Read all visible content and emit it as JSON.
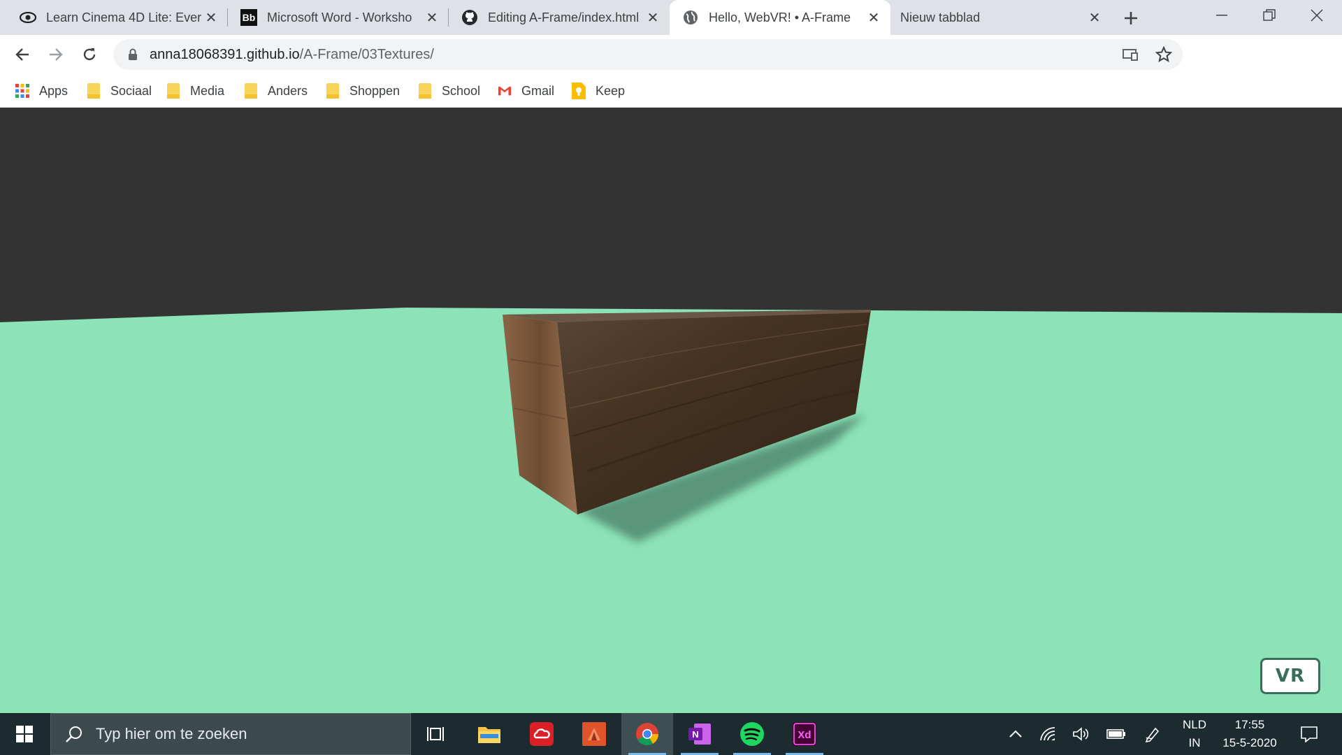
{
  "tabs": [
    {
      "title": "Learn Cinema 4D Lite: Every",
      "favicon": "eye-icon"
    },
    {
      "title": "Microsoft Word - Worksho",
      "favicon": "blackboard-icon",
      "favicon_text": "Bb"
    },
    {
      "title": "Editing A-Frame/index.html",
      "favicon": "github-icon"
    },
    {
      "title": "Hello, WebVR! • A-Frame",
      "favicon": "globe-icon",
      "active": true
    },
    {
      "title": "Nieuw tabblad",
      "favicon": "none"
    }
  ],
  "address": {
    "host": "anna18068391.github.io",
    "path": "/A-Frame/03Textures/"
  },
  "bookmarks": [
    {
      "label": "Apps",
      "icon": "apps-grid-icon"
    },
    {
      "label": "Sociaal",
      "icon": "folder-icon"
    },
    {
      "label": "Media",
      "icon": "folder-icon"
    },
    {
      "label": "Anders",
      "icon": "folder-icon"
    },
    {
      "label": "Shoppen",
      "icon": "folder-icon"
    },
    {
      "label": "School",
      "icon": "folder-icon"
    },
    {
      "label": "Gmail",
      "icon": "gmail-icon"
    },
    {
      "label": "Keep",
      "icon": "keep-icon"
    }
  ],
  "scene": {
    "sky_color": "#333333",
    "ground_color": "#8ce3b7",
    "box_texture": "dark wood",
    "vr_button_label": "VR"
  },
  "taskbar": {
    "search_placeholder": "Typ hier om te zoeken",
    "apps": [
      "task-view-icon",
      "file-explorer-icon",
      "creative-cloud-icon",
      "affinity-icon",
      "chrome-icon",
      "onenote-icon",
      "spotify-icon",
      "adobe-xd-icon"
    ],
    "xd_label": "Xd",
    "onenote_label": "N",
    "language": "NLD",
    "input_mode": "IN",
    "time": "17:55",
    "date": "15-5-2020"
  }
}
